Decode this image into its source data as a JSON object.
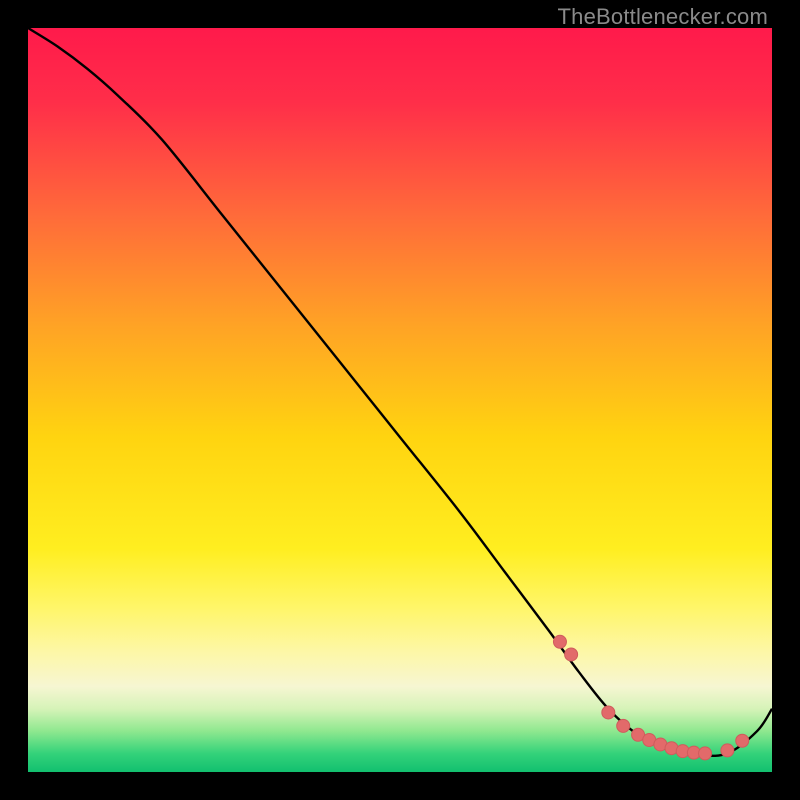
{
  "attribution": "TheBottlenecker.com",
  "colors": {
    "gradient_stops": [
      {
        "offset": 0.0,
        "color": "#ff1a4b"
      },
      {
        "offset": 0.1,
        "color": "#ff2e49"
      },
      {
        "offset": 0.25,
        "color": "#ff6a3a"
      },
      {
        "offset": 0.4,
        "color": "#ffa325"
      },
      {
        "offset": 0.55,
        "color": "#ffd410"
      },
      {
        "offset": 0.7,
        "color": "#ffee20"
      },
      {
        "offset": 0.78,
        "color": "#fff66a"
      },
      {
        "offset": 0.84,
        "color": "#fdf7a8"
      },
      {
        "offset": 0.885,
        "color": "#f6f6d2"
      },
      {
        "offset": 0.915,
        "color": "#d6f3b8"
      },
      {
        "offset": 0.945,
        "color": "#8fe88f"
      },
      {
        "offset": 0.975,
        "color": "#34d27a"
      },
      {
        "offset": 1.0,
        "color": "#12c06f"
      }
    ],
    "curve_stroke": "#000000",
    "marker_fill": "#e26a6a",
    "marker_stroke": "#cf5c5c"
  },
  "chart_data": {
    "type": "line",
    "title": "",
    "xlabel": "",
    "ylabel": "",
    "xlim": [
      0,
      100
    ],
    "ylim": [
      0,
      100
    ],
    "grid": false,
    "legend": false,
    "series": [
      {
        "name": "bottleneck-curve",
        "x": [
          0,
          4,
          8,
          12,
          18,
          26,
          34,
          42,
          50,
          58,
          64,
          70,
          74,
          78,
          82,
          86,
          90,
          94,
          98,
          100
        ],
        "y": [
          100,
          97.5,
          94.5,
          91,
          85,
          75,
          65,
          55,
          45,
          35,
          27,
          19,
          13.5,
          8.5,
          5,
          3,
          2.3,
          2.5,
          5.5,
          8.5
        ]
      }
    ],
    "markers": {
      "name": "highlight-dots",
      "x": [
        71.5,
        73,
        78,
        80,
        82,
        83.5,
        85,
        86.5,
        88,
        89.5,
        91,
        94,
        96
      ],
      "y": [
        17.5,
        15.8,
        8.0,
        6.2,
        5.0,
        4.3,
        3.7,
        3.2,
        2.8,
        2.6,
        2.5,
        2.9,
        4.2
      ]
    }
  }
}
